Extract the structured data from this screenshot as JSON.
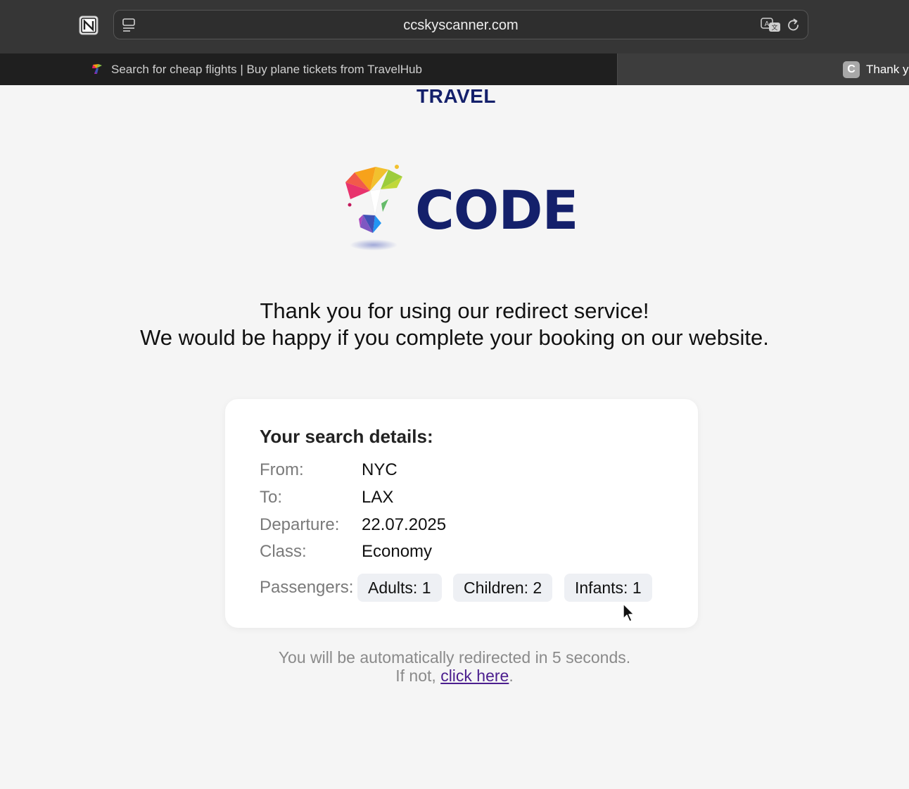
{
  "browser": {
    "url": "ccskyscanner.com",
    "tabs": [
      {
        "title": "Search for cheap flights | Buy plane tickets from TravelHub",
        "active": true
      },
      {
        "badge": "C",
        "title": "Thank y",
        "active": false
      }
    ]
  },
  "logo": {
    "line1": "TRAVEL",
    "line2": "CODE",
    "color": "#14206b"
  },
  "headline": {
    "line1": "Thank you for using our redirect service!",
    "line2": "We would be happy if you complete your booking on our website."
  },
  "search_details": {
    "title": "Your search details:",
    "rows": [
      {
        "label": "From:",
        "value": "NYC"
      },
      {
        "label": "To:",
        "value": "LAX"
      },
      {
        "label": "Departure:",
        "value": "22.07.2025"
      },
      {
        "label": "Class:",
        "value": "Economy"
      }
    ],
    "passengers_label": "Passengers:",
    "passengers": [
      "Adults: 1",
      "Children: 2",
      "Infants: 1"
    ]
  },
  "redirect": {
    "line1": "You will be automatically redirected in 5 seconds.",
    "prefix": "If not, ",
    "link_text": "click here",
    "suffix": "."
  },
  "icons": {
    "notion": "notion-icon",
    "sidebar": "sidebar-icon",
    "translate": "translate-icon",
    "reload": "reload-icon",
    "cursor": "mouse-cursor-icon"
  }
}
